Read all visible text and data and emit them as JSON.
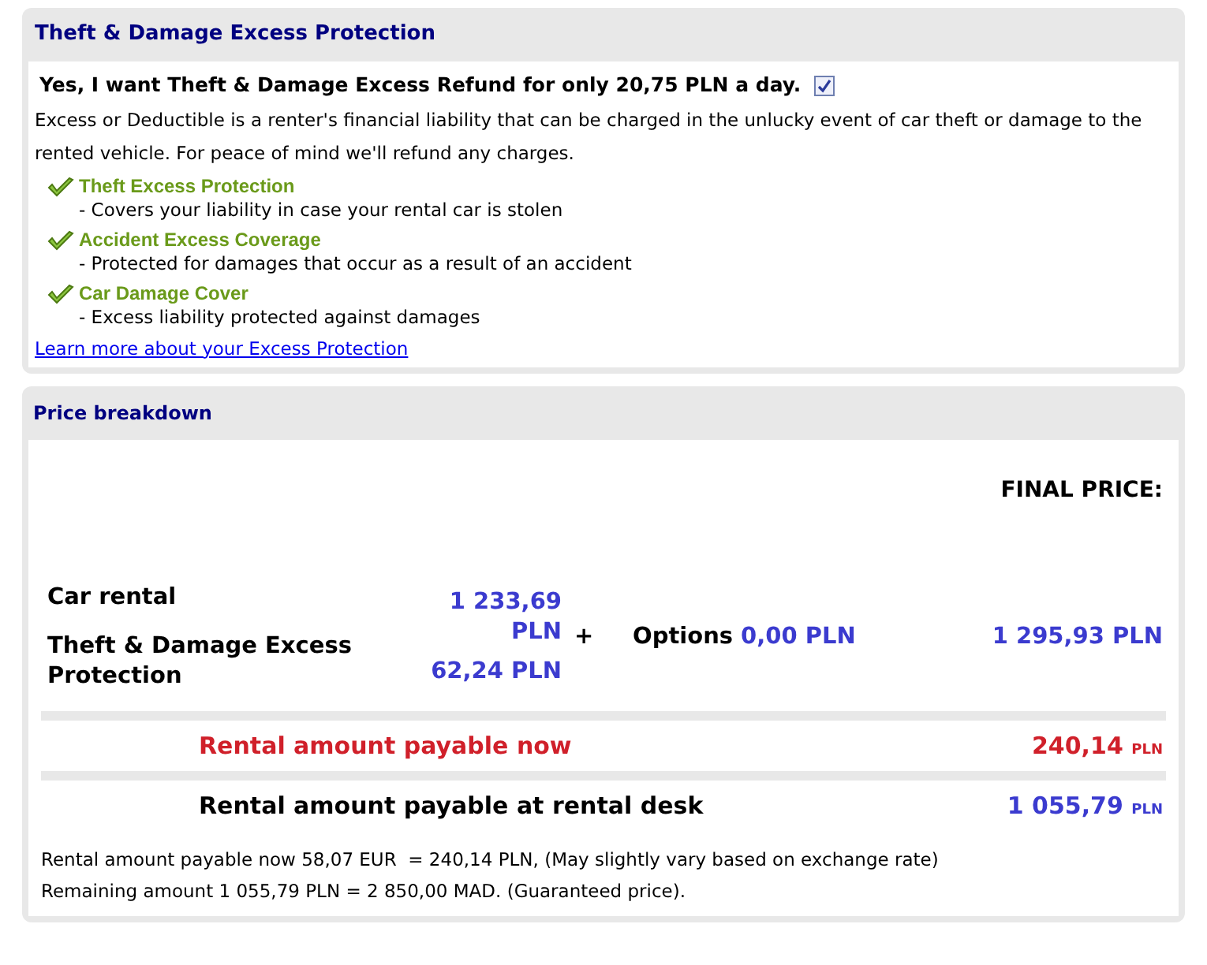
{
  "excess": {
    "title": "Theft & Damage Excess Protection",
    "offer": {
      "text": "Yes, I want Theft & Damage Excess Refund for only 20,75 PLN a day.",
      "checked": true
    },
    "description": "Excess or Deductible is a renter's financial liability that can be charged in the unlucky event of car theft or damage to the rented vehicle. For peace of mind we'll refund any charges.",
    "benefits": [
      {
        "title": "Theft Excess Protection",
        "description": "- Covers your liability in case your rental car is stolen"
      },
      {
        "title": "Accident Excess Coverage",
        "description": "- Protected for damages that occur as a result of an accident"
      },
      {
        "title": "Car Damage Cover",
        "description": "- Excess liability protected against damages"
      }
    ],
    "link": "Learn more about your Excess Protection"
  },
  "price": {
    "title": "Price breakdown",
    "final_label": "FINAL PRICE:",
    "items": [
      {
        "label": "Car rental",
        "value": "1 233,69 PLN"
      },
      {
        "label": "Theft & Damage Excess Protection",
        "value": "62,24 PLN"
      }
    ],
    "plus": "+",
    "options_label": "Options",
    "options_value": "0,00 PLN",
    "final_value": "1 295,93 PLN",
    "payable": [
      {
        "kind": "now",
        "label": "Rental amount payable now",
        "amount": "240,14",
        "currency": "PLN"
      },
      {
        "kind": "desk",
        "label": "Rental amount payable at rental desk",
        "amount": "1 055,79",
        "currency": "PLN"
      }
    ],
    "notes": [
      "Rental amount payable now 58,07 EUR  = 240,14 PLN, (May slightly vary based on exchange rate)",
      "Remaining amount 1 055,79 PLN = 2 850,00 MAD. (Guaranteed price)."
    ]
  }
}
